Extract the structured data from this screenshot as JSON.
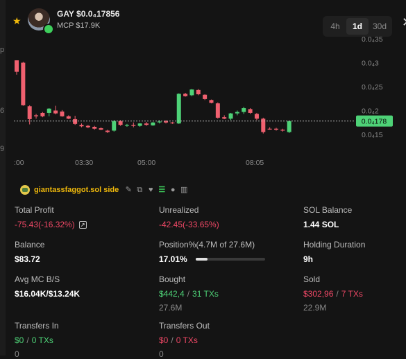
{
  "edge": {
    "labels": [
      "p",
      "6",
      "9"
    ]
  },
  "token": {
    "name": "GAY $0.0₄17856",
    "mcp": "MCP $17.9K"
  },
  "timeframes": [
    {
      "label": "4h",
      "active": false
    },
    {
      "label": "1d",
      "active": true
    },
    {
      "label": "30d",
      "active": false
    }
  ],
  "chart_data": {
    "type": "candlestick",
    "y_tick_labels": [
      "0.0₄35",
      "0.0₄3",
      "0.0₄25",
      "0.0₄2",
      "0.0₄15"
    ],
    "y_ticks": [
      3.5e-05,
      3e-05,
      2.5e-05,
      2e-05,
      1.5e-05
    ],
    "x_tick_labels": [
      ":00",
      "03:30",
      "05:00",
      "08:05"
    ],
    "current_price_label": "0.0₄178",
    "current_price": 1.78e-05,
    "colors": {
      "up": "#4ed277",
      "down": "#f0606f",
      "price_line": "#bfbfbf"
    },
    "candles": [
      {
        "o": 3.05e-05,
        "h": 3.05e-05,
        "l": 2.75e-05,
        "c": 2.81e-05
      },
      {
        "o": 3e-05,
        "h": 3.02e-05,
        "l": 2.1e-05,
        "c": 2.11e-05
      },
      {
        "o": 2.09e-05,
        "h": 2.11e-05,
        "l": 1.71e-05,
        "c": 1.82e-05
      },
      {
        "o": 1.9e-05,
        "h": 1.93e-05,
        "l": 1.83e-05,
        "c": 1.88e-05
      },
      {
        "o": 1.95e-05,
        "h": 1.97e-05,
        "l": 1.86e-05,
        "c": 1.88e-05
      },
      {
        "o": 1.95e-05,
        "h": 2.05e-05,
        "l": 1.88e-05,
        "c": 2.04e-05
      },
      {
        "o": 2e-05,
        "h": 2.1e-05,
        "l": 1.92e-05,
        "c": 1.94e-05
      },
      {
        "o": 1.98e-05,
        "h": 2.01e-05,
        "l": 1.87e-05,
        "c": 1.88e-05
      },
      {
        "o": 1.88e-05,
        "h": 1.9e-05,
        "l": 1.82e-05,
        "c": 1.83e-05
      },
      {
        "o": 1.82e-05,
        "h": 1.89e-05,
        "l": 1.7e-05,
        "c": 1.72e-05
      },
      {
        "o": 1.7e-05,
        "h": 1.73e-05,
        "l": 1.65e-05,
        "c": 1.67e-05
      },
      {
        "o": 1.68e-05,
        "h": 1.7e-05,
        "l": 1.63e-05,
        "c": 1.65e-05
      },
      {
        "o": 1.66e-05,
        "h": 1.68e-05,
        "l": 1.6e-05,
        "c": 1.62e-05
      },
      {
        "o": 1.63e-05,
        "h": 1.65e-05,
        "l": 1.59e-05,
        "c": 1.6e-05
      },
      {
        "o": 1.58e-05,
        "h": 1.6e-05,
        "l": 1.53e-05,
        "c": 1.55e-05
      },
      {
        "o": 1.58e-05,
        "h": 1.8e-05,
        "l": 1.56e-05,
        "c": 1.78e-05
      },
      {
        "o": 1.78e-05,
        "h": 1.8e-05,
        "l": 1.68e-05,
        "c": 1.7e-05
      },
      {
        "o": 1.7e-05,
        "h": 1.72e-05,
        "l": 1.66e-05,
        "c": 1.7e-05
      },
      {
        "o": 1.7e-05,
        "h": 1.75e-05,
        "l": 1.65e-05,
        "c": 1.68e-05
      },
      {
        "o": 1.68e-05,
        "h": 1.74e-05,
        "l": 1.66e-05,
        "c": 1.73e-05
      },
      {
        "o": 1.73e-05,
        "h": 1.76e-05,
        "l": 1.68e-05,
        "c": 1.7e-05
      },
      {
        "o": 1.69e-05,
        "h": 1.76e-05,
        "l": 1.68e-05,
        "c": 1.75e-05
      },
      {
        "o": 1.76e-05,
        "h": 1.8e-05,
        "l": 1.73e-05,
        "c": 1.77e-05
      },
      {
        "o": 1.78e-05,
        "h": 1.8e-05,
        "l": 1.73e-05,
        "c": 1.75e-05
      },
      {
        "o": 1.75e-05,
        "h": 1.76e-05,
        "l": 1.72e-05,
        "c": 1.74e-05
      },
      {
        "o": 1.73e-05,
        "h": 2.36e-05,
        "l": 1.72e-05,
        "c": 2.35e-05
      },
      {
        "o": 2.35e-05,
        "h": 2.37e-05,
        "l": 2.29e-05,
        "c": 2.3e-05
      },
      {
        "o": 2.32e-05,
        "h": 2.45e-05,
        "l": 2.3e-05,
        "c": 2.44e-05
      },
      {
        "o": 2.43e-05,
        "h": 2.45e-05,
        "l": 2.32e-05,
        "c": 2.34e-05
      },
      {
        "o": 2.33e-05,
        "h": 2.34e-05,
        "l": 2.22e-05,
        "c": 2.24e-05
      },
      {
        "o": 2.22e-05,
        "h": 2.23e-05,
        "l": 2.15e-05,
        "c": 2.16e-05
      },
      {
        "o": 2.15e-05,
        "h": 2.17e-05,
        "l": 1.83e-05,
        "c": 1.85e-05
      },
      {
        "o": 1.86e-05,
        "h": 1.9e-05,
        "l": 1.82e-05,
        "c": 1.83e-05
      },
      {
        "o": 1.83e-05,
        "h": 1.95e-05,
        "l": 1.8e-05,
        "c": 1.94e-05
      },
      {
        "o": 1.94e-05,
        "h": 2e-05,
        "l": 1.9e-05,
        "c": 1.97e-05
      },
      {
        "o": 1.97e-05,
        "h": 2.08e-05,
        "l": 1.93e-05,
        "c": 2.05e-05
      },
      {
        "o": 2.03e-05,
        "h": 2.05e-05,
        "l": 1.93e-05,
        "c": 1.95e-05
      },
      {
        "o": 1.93e-05,
        "h": 1.95e-05,
        "l": 1.8e-05,
        "c": 1.83e-05
      },
      {
        "o": 1.83e-05,
        "h": 1.85e-05,
        "l": 1.52e-05,
        "c": 1.55e-05
      },
      {
        "o": 1.62e-05,
        "h": 1.65e-05,
        "l": 1.6e-05,
        "c": 1.61e-05
      },
      {
        "o": 1.62e-05,
        "h": 1.64e-05,
        "l": 1.58e-05,
        "c": 1.6e-05
      },
      {
        "o": 1.6e-05,
        "h": 1.62e-05,
        "l": 1.56e-05,
        "c": 1.58e-05
      },
      {
        "o": 1.55e-05,
        "h": 1.79e-05,
        "l": 1.53e-05,
        "c": 1.78e-05
      }
    ]
  },
  "wallet": {
    "name": "giantassfaggot.sol side"
  },
  "stats": {
    "total_profit": {
      "label": "Total Profit",
      "value": "-75.43(-16.32%)"
    },
    "unrealized": {
      "label": "Unrealized",
      "value": "-42.45(-33.65%)"
    },
    "sol_balance": {
      "label": "SOL Balance",
      "value": "1.44 SOL"
    },
    "balance": {
      "label": "Balance",
      "value": "$83.72"
    },
    "position": {
      "label": "Position%(4.7M of 27.6M)",
      "value": "17.01%",
      "fraction": 0.1701
    },
    "holding": {
      "label": "Holding Duration",
      "value": "9h"
    },
    "avg_mc": {
      "label": "Avg MC B/S",
      "value": "$16.04K/$13.24K"
    },
    "bought": {
      "label": "Bought",
      "amount": "$442,4",
      "txs": "31 TXs",
      "sub": "27.6M"
    },
    "sold": {
      "label": "Sold",
      "amount": "$302,96",
      "txs": "7 TXs",
      "sub": "22.9M"
    },
    "transfers_in": {
      "label": "Transfers In",
      "amount": "$0",
      "txs": "0 TXs",
      "sub": "0"
    },
    "transfers_out": {
      "label": "Transfers Out",
      "amount": "$0",
      "txs": "0 TXs",
      "sub": "0"
    }
  }
}
